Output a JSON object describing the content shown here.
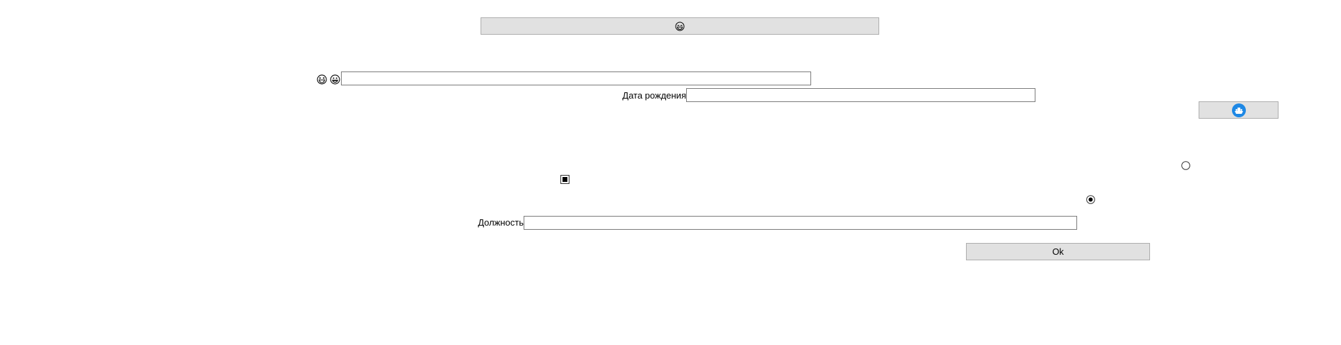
{
  "top_button": {
    "icon": "smiley-face-icon"
  },
  "name_row": {
    "icons": [
      "laughing-face-icon",
      "grinning-face-icon"
    ],
    "input_value": ""
  },
  "birth_date": {
    "label": "Дата рождения",
    "input_value": ""
  },
  "side_button": {
    "icon": "ship-icon",
    "accent": "#1e88e5"
  },
  "radio_top": {
    "checked": false
  },
  "checkbox": {
    "checked": true
  },
  "radio_bottom": {
    "checked": true
  },
  "position": {
    "label": "Должность",
    "input_value": ""
  },
  "ok_button": {
    "label": "Ok"
  },
  "colors": {
    "button_bg": "#e1e1e1",
    "button_border": "#adadad",
    "field_border": "#7a7a7a"
  }
}
